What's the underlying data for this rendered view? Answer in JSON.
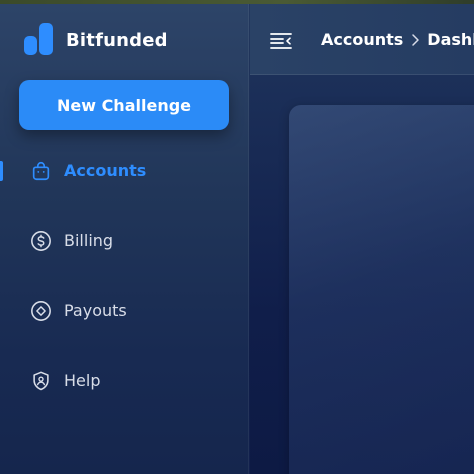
{
  "brand": {
    "name": "Bitfunded",
    "color": "#2e8dff"
  },
  "sidebar": {
    "new_button_label": "New Challenge",
    "items": [
      {
        "label": "Accounts",
        "icon": "shopping-bag-icon",
        "active": true
      },
      {
        "label": "Billing",
        "icon": "dollar-circle-icon",
        "active": false
      },
      {
        "label": "Payouts",
        "icon": "diamond-circle-icon",
        "active": false
      },
      {
        "label": "Help",
        "icon": "shield-user-icon",
        "active": false
      }
    ]
  },
  "topbar": {
    "menu_icon": "collapse-menu-icon",
    "breadcrumb": [
      "Accounts",
      "Dashboard"
    ]
  },
  "colors": {
    "accent": "#2b8bf7",
    "active_text": "#2e8dff",
    "nav_text": "#d8dde8",
    "sidebar_bg": "#213659"
  }
}
